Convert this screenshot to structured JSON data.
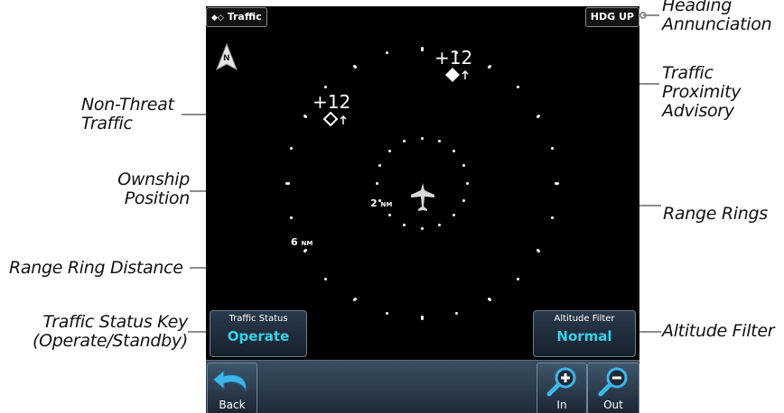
{
  "screen": {
    "title": "Traffic",
    "heading_mode": "HDG UP",
    "north_indicator": "N",
    "traffic": [
      {
        "relative_altitude": "+12",
        "kind": "proximity-advisory"
      },
      {
        "relative_altitude": "+12",
        "kind": "non-threat"
      }
    ],
    "inner_range": {
      "value": "2",
      "unit": "NM"
    },
    "outer_range": {
      "value": "6",
      "unit": "NM"
    },
    "traffic_status": {
      "title": "Traffic Status",
      "value": "Operate"
    },
    "altitude_filter": {
      "title": "Altitude Filter",
      "value": "Normal"
    },
    "back_label": "Back",
    "zoom_in_label": "In",
    "zoom_out_label": "Out",
    "colors": {
      "value_text": "#36d2e6",
      "background": "#000000"
    }
  },
  "callouts": {
    "heading": [
      "Heading",
      "Annunciation"
    ],
    "proximity": [
      "Traffic",
      "Proximity",
      "Advisory"
    ],
    "non_threat": [
      "Non-Threat",
      "Traffic"
    ],
    "ownship": [
      "Ownship",
      "Position"
    ],
    "range_rings": "Range Rings",
    "range_distance": "Range Ring Distance",
    "status_key": [
      "Traffic Status Key",
      "(Operate/Standby)"
    ],
    "altitude_filter": "Altitude Filter"
  }
}
